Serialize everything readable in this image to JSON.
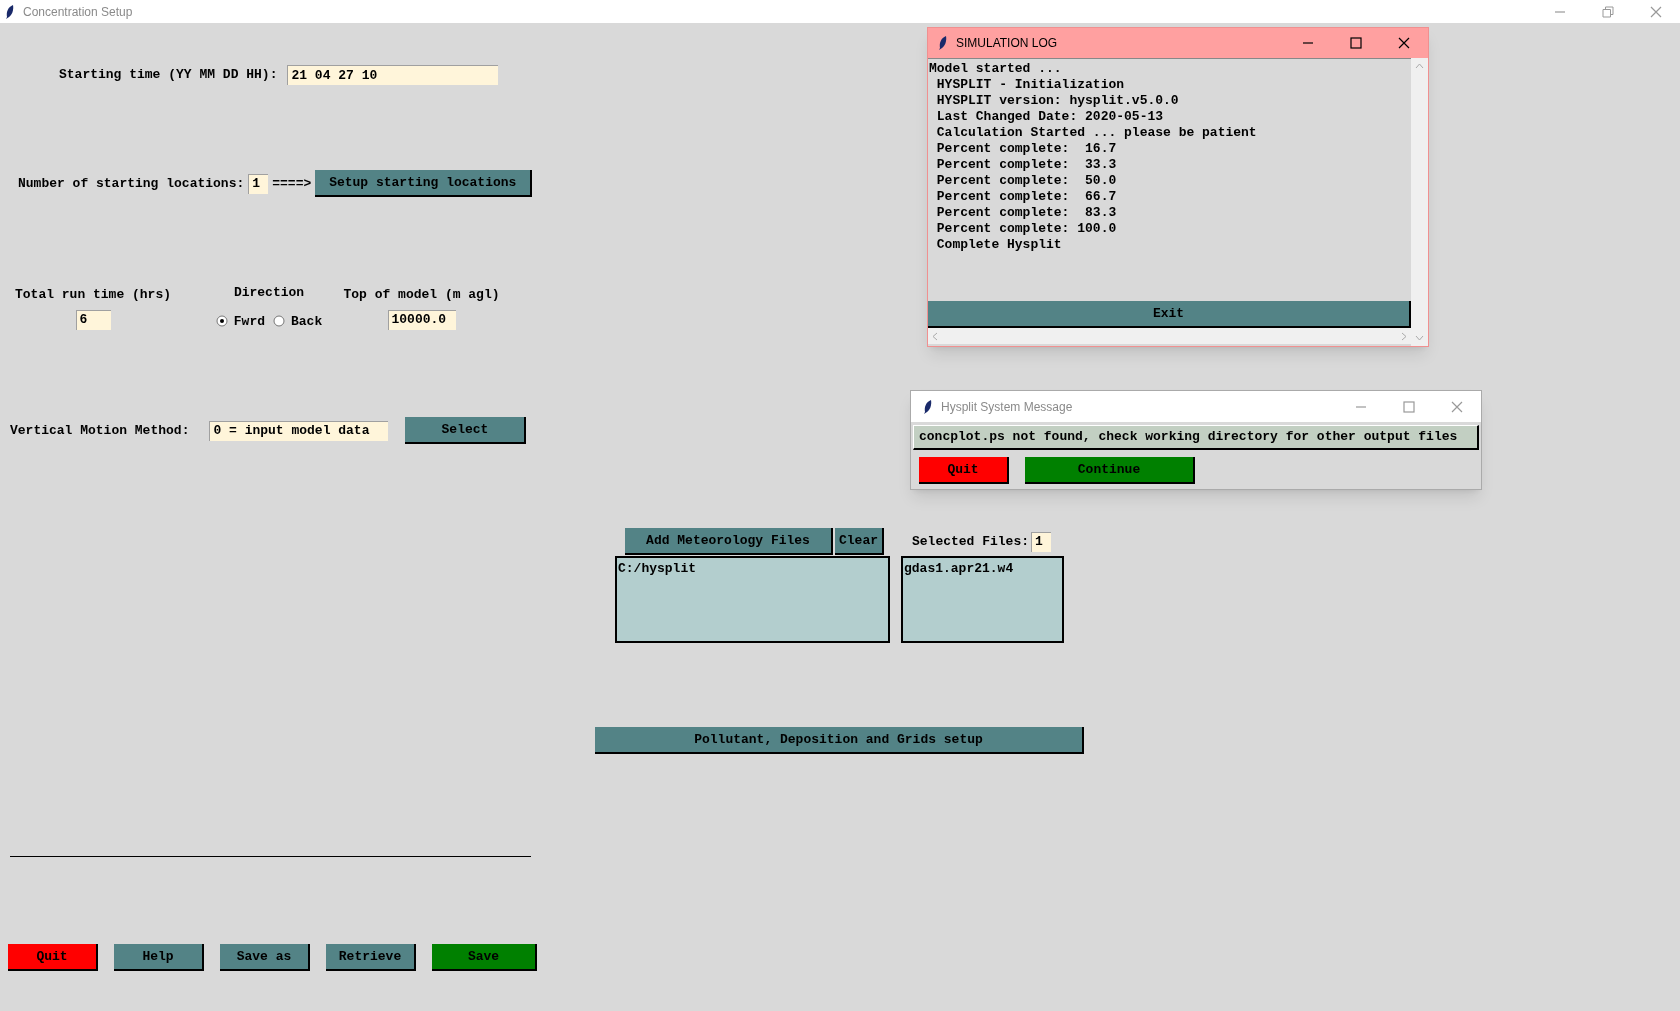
{
  "window": {
    "title": "Concentration Setup"
  },
  "starting_time": {
    "label": "Starting time (YY MM DD HH):",
    "value": "21 04 27 10"
  },
  "starting_locations": {
    "label": "Number of starting locations:",
    "value": "1",
    "arrow": "====>",
    "button": "Setup starting locations"
  },
  "run_time": {
    "label": "Total run time (hrs)",
    "value": "6"
  },
  "direction": {
    "label": "Direction",
    "options": [
      {
        "label": "Fwrd",
        "selected": true
      },
      {
        "label": "Back",
        "selected": false
      }
    ]
  },
  "top_of_model": {
    "label": "Top of model (m agl)",
    "value": "10000.0"
  },
  "vertical_motion": {
    "label": "Vertical Motion Method:",
    "value": "0 = input model data",
    "button": "Select"
  },
  "meteorology": {
    "add_button": "Add Meteorology Files",
    "clear_button": "Clear",
    "selected_label": "Selected Files:",
    "selected_count": "1",
    "directories": [
      "C:/hysplit"
    ],
    "files": [
      "gdas1.apr21.w4"
    ]
  },
  "setup_button": "Pollutant, Deposition and Grids setup",
  "buttons": [
    {
      "label": "Quit",
      "kind": "danger"
    },
    {
      "label": "Help",
      "kind": "normal"
    },
    {
      "label": "Save as",
      "kind": "normal"
    },
    {
      "label": "Retrieve",
      "kind": "normal"
    },
    {
      "label": "Save",
      "kind": "confirm"
    }
  ],
  "simulation_log": {
    "title": "SIMULATION LOG",
    "lines": [
      "Model started ...",
      " HYSPLIT - Initialization",
      " HYSPLIT version: hysplit.v5.0.0",
      " Last Changed Date: 2020-05-13",
      " Calculation Started ... please be patient",
      " Percent complete:  16.7",
      " Percent complete:  33.3",
      " Percent complete:  50.0",
      " Percent complete:  66.7",
      " Percent complete:  83.3",
      " Percent complete: 100.0",
      " Complete Hysplit"
    ],
    "button": "Exit"
  },
  "message_dialog": {
    "title": "Hysplit System Message",
    "message": "concplot.ps not found, check working directory for other output files",
    "buttons": [
      {
        "label": "Quit",
        "kind": "danger"
      },
      {
        "label": "Continue",
        "kind": "confirm"
      }
    ]
  }
}
